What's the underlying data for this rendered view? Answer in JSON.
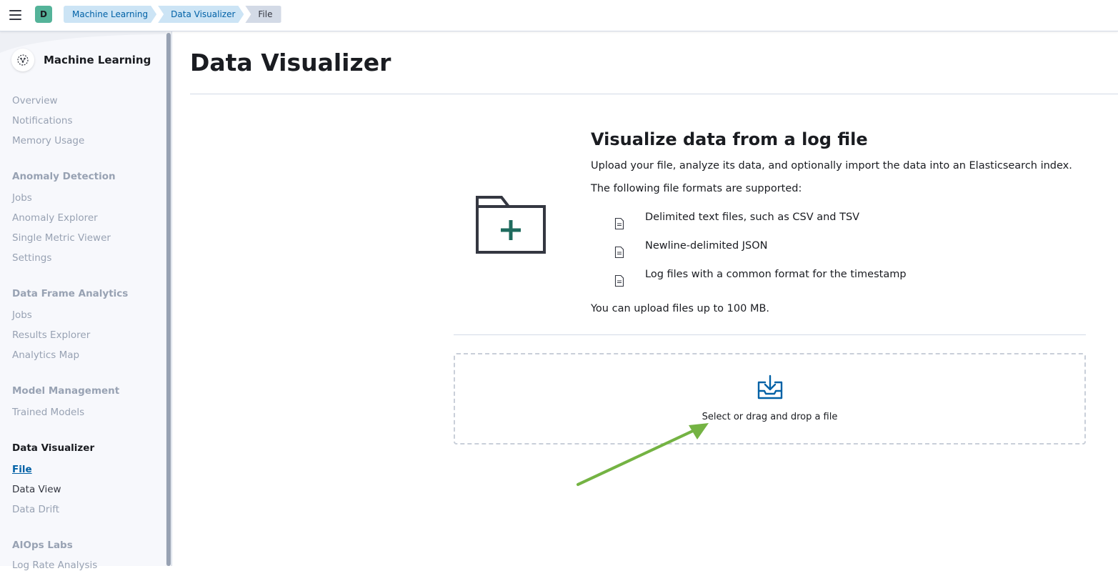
{
  "header": {
    "space_initial": "D",
    "breadcrumbs": [
      "Machine Learning",
      "Data Visualizer",
      "File"
    ]
  },
  "sidebar": {
    "title": "Machine Learning",
    "items": [
      {
        "label": "Overview",
        "kind": "item"
      },
      {
        "label": "Notifications",
        "kind": "item"
      },
      {
        "label": "Memory Usage",
        "kind": "item"
      },
      {
        "label": "Anomaly Detection",
        "kind": "group"
      },
      {
        "label": "Jobs",
        "kind": "item"
      },
      {
        "label": "Anomaly Explorer",
        "kind": "item"
      },
      {
        "label": "Single Metric Viewer",
        "kind": "item"
      },
      {
        "label": "Settings",
        "kind": "item"
      },
      {
        "label": "Data Frame Analytics",
        "kind": "group"
      },
      {
        "label": "Jobs",
        "kind": "item"
      },
      {
        "label": "Results Explorer",
        "kind": "item"
      },
      {
        "label": "Analytics Map",
        "kind": "item"
      },
      {
        "label": "Model Management",
        "kind": "group"
      },
      {
        "label": "Trained Models",
        "kind": "item"
      },
      {
        "label": "Data Visualizer",
        "kind": "active-group"
      },
      {
        "label": "File",
        "kind": "current"
      },
      {
        "label": "Data View",
        "kind": "dark"
      },
      {
        "label": "Data Drift",
        "kind": "item"
      },
      {
        "label": "AIOps Labs",
        "kind": "group"
      },
      {
        "label": "Log Rate Analysis",
        "kind": "item"
      }
    ]
  },
  "main": {
    "page_title": "Data Visualizer",
    "hero_title": "Visualize data from a log file",
    "hero_description": "Upload your file, analyze its data, and optionally import the data into an Elasticsearch index.",
    "formats_intro": "The following file formats are supported:",
    "formats": [
      "Delimited text files, such as CSV and TSV",
      "Newline-delimited JSON",
      "Log files with a common format for the timestamp"
    ],
    "limit_text": "You can upload files up to 100 MB.",
    "dropzone_label": "Select or drag and drop a file"
  },
  "colors": {
    "accent": "#0061a6",
    "folder_plus": "#1f6b5e",
    "arrow": "#74b343",
    "avatar": "#54b399"
  },
  "icons": [
    "menu-icon",
    "ml-logo-icon",
    "folder-add-icon",
    "document-icon",
    "upload-icon",
    "annotation-arrow"
  ]
}
